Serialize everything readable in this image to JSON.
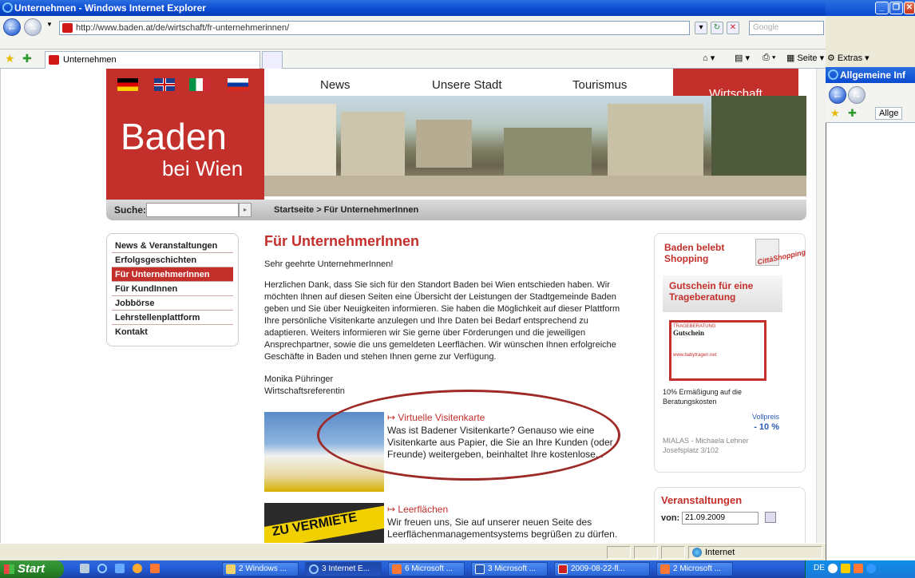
{
  "window": {
    "title": "Unternehmen - Windows Internet Explorer",
    "url": "http://www.baden.at/de/wirtschaft/fr-unternehmerinnen/",
    "search_placeholder": "Google",
    "tab_label": "Unternehmen",
    "tools": {
      "page": "Seite",
      "extras": "Extras"
    }
  },
  "second_window": {
    "title": "Allgemeine Inf",
    "tab": "Allge"
  },
  "site": {
    "logo_line1": "Baden",
    "logo_line2": "bei Wien",
    "nav": [
      "News",
      "Unsere Stadt",
      "Tourismus",
      "Wirtschaft"
    ],
    "search_label": "Suche:",
    "breadcrumb": "Startseite > Für UnternehmerInnen",
    "sidenav": [
      "News & Veranstaltungen",
      "Erfolgsgeschichten",
      "Für UnternehmerInnen",
      "Für KundInnen",
      "Jobbörse",
      "Lehrstellenplattform",
      "Kontakt"
    ],
    "heading": "Für UnternehmerInnen",
    "greeting": "Sehr geehrte UnternehmerInnen!",
    "body": "Herzlichen Dank, dass Sie sich für den Standort Baden bei Wien entschieden haben. Wir möchten Ihnen auf diesen Seiten eine Übersicht der Leistungen der Stadtgemeinde Baden geben und Sie über Neuigkeiten informieren. Sie haben die Möglichkeit auf dieser Plattform Ihre persönliche Visitenkarte anzulegen und Ihre Daten bei Bedarf entsprechend zu adaptieren. Weiters informieren wir Sie gerne über Förderungen und die jeweiligen Ansprechpartner, sowie die uns gemeldeten Leerflächen. Wir wünschen Ihnen erfolgreiche Geschäfte in Baden und stehen Ihnen gerne zur Verfügung.",
    "signature_name": "Monika Pühringer",
    "signature_role": "Wirtschaftsreferentin",
    "teaser1_title": "Virtuelle Visitenkarte",
    "teaser1_text": "Was ist Badener Visitenkarte? Genauso wie eine Visitenkarte aus Papier, die Sie an Ihre Kunden (oder Freunde) weitergeben, beinhaltet Ihre kostenlose...",
    "teaser2_title": "Leerflächen",
    "teaser2_text": "Wir freuen uns, Sie auf unserer neuen Seite des Leerflächenmanagementsystems begrüßen zu dürfen.",
    "teaser2_img_text": "ZU VERMIETE",
    "promo_title": "Baden belebt Shopping",
    "promo_badge": "CittàShopping",
    "voucher_title": "Gutschein für eine Trageberatung",
    "voucher_card_title": "Gutschein",
    "voucher_card_head": "TRAGEBERATUNG",
    "voucher_card_url": "www.babytragen.net",
    "voucher_desc": "10% Ermäßigung auf die Beratungskosten",
    "voucher_price_label": "Vollpreis",
    "voucher_price": "- 10 %",
    "voucher_vendor": "MIALAS - Michaela Lehner Josefsplatz 3/102",
    "events_title": "Veranstaltungen",
    "events_from_label": "von:",
    "events_from_value": "21.09.2009"
  },
  "status": {
    "zone": "Internet"
  },
  "taskbar": {
    "start": "Start",
    "tasks": [
      "2 Windows ...",
      "3 Internet E...",
      "6 Microsoft ...",
      "3 Microsoft ...",
      "2009-08-22-fl...",
      "2 Microsoft ..."
    ],
    "lang": "DE"
  },
  "colors": {
    "brand_red": "#c32f2b",
    "xp_blue": "#245edb"
  }
}
